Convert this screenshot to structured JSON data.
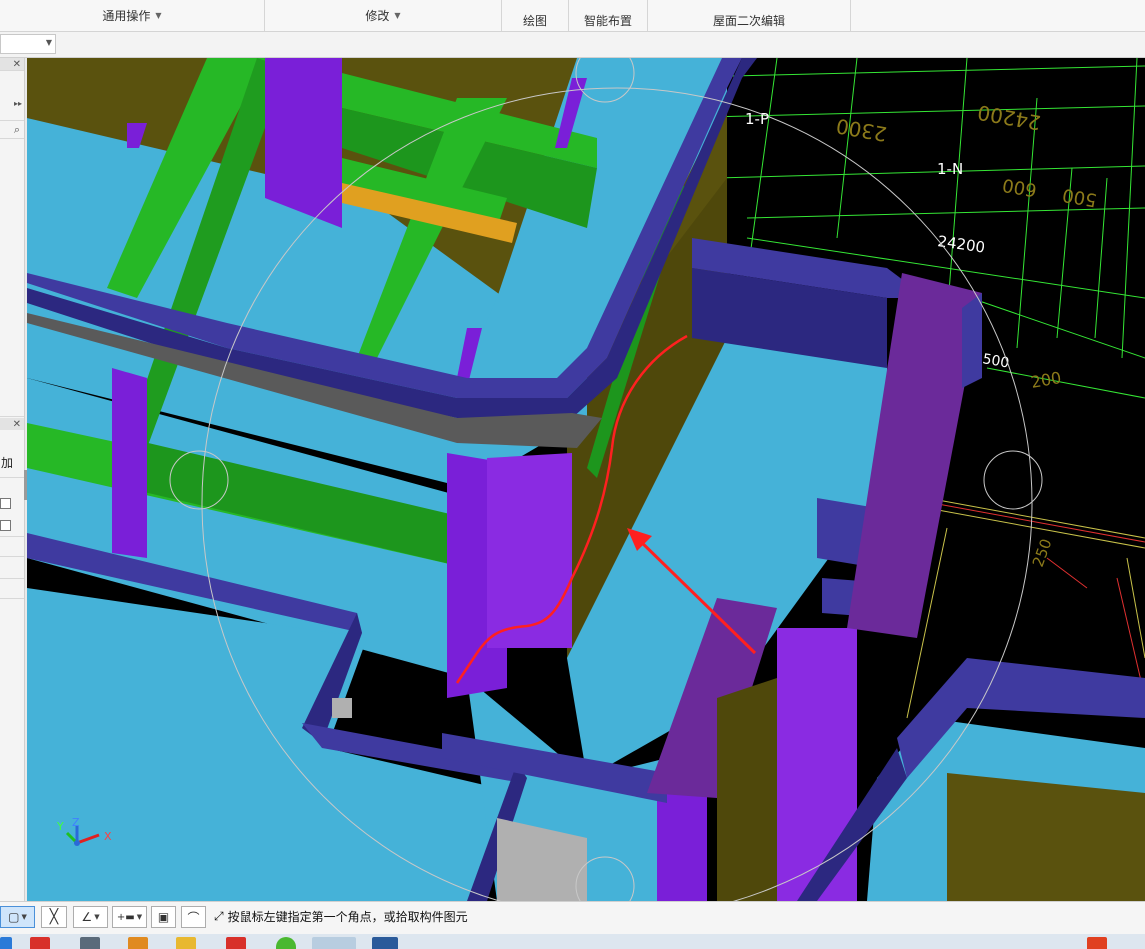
{
  "ribbon": {
    "groups": [
      {
        "label": "通用操作",
        "dropdown": true
      },
      {
        "label": "修改",
        "dropdown": true
      },
      {
        "label": "绘图",
        "dropdown": false
      },
      {
        "label": "智能布置",
        "dropdown": false
      },
      {
        "label": "屋面二次编辑",
        "dropdown": false
      }
    ]
  },
  "left_panel": {
    "add_label": "加",
    "icons": [
      "expand-icon",
      "search-icon",
      "close-icon"
    ]
  },
  "viewport": {
    "dims": [
      "1-P",
      "1-N",
      "24200",
      "500",
      "2300",
      "24200",
      "600",
      "600",
      "500",
      "200",
      "250"
    ],
    "axis": {
      "x": "X",
      "y": "Y",
      "z": "Z"
    },
    "colors": {
      "background": "#000000",
      "slab": "#45b2d8",
      "wall": "#3f3aa0",
      "column": "#7a1fd8",
      "beam": "#26b826",
      "olive": "#5a520e",
      "grid": "#35e635",
      "annotation": "#ff2020"
    }
  },
  "statusbar": {
    "prompt": "按鼠标左键指定第一个角点，或拾取构件图元",
    "tools": [
      "rectangle-select-icon",
      "cross-select-icon",
      "angle-icon",
      "insert-point-icon",
      "copy-view-icon",
      "arc-icon"
    ]
  },
  "taskbar": {
    "apps": [
      "pdf-app-icon",
      "calculator-app-icon",
      "browser-app-icon",
      "folder-app-icon",
      "wps-app-icon",
      "green-app-icon",
      "active-app-icon",
      "glodon-app-icon",
      "ime-icon"
    ]
  }
}
